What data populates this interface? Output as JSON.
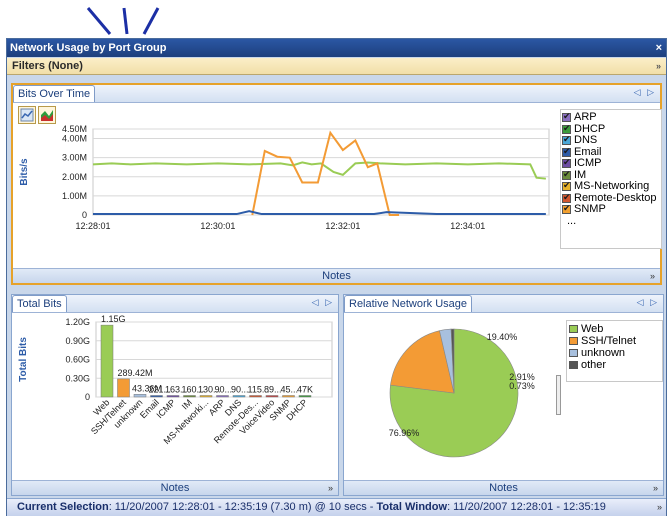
{
  "window": {
    "title": "Network Usage by Port Group",
    "close_glyph": "×"
  },
  "filters": {
    "label": "Filters (None)",
    "chevron": "»"
  },
  "bits_panel": {
    "tab": "Bits Over Time",
    "arrows": "◁ ▷",
    "notes": "Notes",
    "notes_chevron": "»",
    "legend": [
      {
        "label": "ARP",
        "color": "#8a6fc0"
      },
      {
        "label": "DHCP",
        "color": "#3c9c3c"
      },
      {
        "label": "DNS",
        "color": "#4aa7d8"
      },
      {
        "label": "Email",
        "color": "#2d5ca8"
      },
      {
        "label": "ICMP",
        "color": "#6e4da3"
      },
      {
        "label": "IM",
        "color": "#6a8b3a"
      },
      {
        "label": "MS-Networking",
        "color": "#e6b22a"
      },
      {
        "label": "Remote-Desktop",
        "color": "#d2562e"
      },
      {
        "label": "SNMP",
        "color": "#f2a030"
      }
    ],
    "legend_more": "..."
  },
  "total_panel": {
    "tab": "Total Bits",
    "arrows": "◁ ▷",
    "notes": "Notes",
    "notes_chevron": "»"
  },
  "relative_panel": {
    "tab": "Relative Network Usage",
    "arrows": "◁ ▷",
    "notes": "Notes",
    "notes_chevron": "»",
    "legend": [
      {
        "label": "Web",
        "color": "#9acc55"
      },
      {
        "label": "SSH/Telnet",
        "color": "#f39b35"
      },
      {
        "label": "unknown",
        "color": "#a8c0de"
      },
      {
        "label": "other",
        "color": "#555555"
      }
    ]
  },
  "status": {
    "current_label": "Current Selection",
    "current_value": ": 11/20/2007 12:28:01 - 12:35:19 (7.30 m) @ 10 secs  - ",
    "total_label": "Total Window",
    "total_value": ": 11/20/2007 12:28:01 - 12:35:19",
    "chevron": "»"
  },
  "chart_data": [
    {
      "type": "line",
      "ylabel": "Bits/s",
      "ytick_labels": [
        "0",
        "1.00M",
        "2.00M",
        "3.00M",
        "4.00M",
        "4.50M"
      ],
      "ytick_values": [
        0,
        1000000,
        2000000,
        3000000,
        4000000,
        4500000
      ],
      "ylim": [
        0,
        4500000
      ],
      "xtick_labels": [
        "12:28:01",
        "12:30:01",
        "12:32:01",
        "12:34:01"
      ],
      "xtick_minutes": [
        0,
        2,
        4,
        6
      ],
      "xlim_minutes": [
        0,
        7.3
      ],
      "grid": true,
      "series": [
        {
          "name": "Web",
          "color": "#9acc55",
          "x": [
            0,
            0.3,
            0.6,
            1,
            1.5,
            2,
            2.5,
            3,
            3.2,
            3.35,
            3.5,
            3.65,
            3.85,
            4,
            4.2,
            4.4,
            4.6,
            5,
            5.5,
            6,
            6.5,
            7.0,
            7.1,
            7.25
          ],
          "y": [
            2650000,
            2700000,
            2650000,
            2700000,
            2650000,
            2700000,
            2650000,
            2700000,
            2600000,
            2750000,
            2650000,
            2700000,
            2250000,
            2100000,
            2700000,
            2750000,
            2700000,
            2650000,
            2700000,
            2650000,
            2700000,
            2650000,
            1950000,
            1900000
          ]
        },
        {
          "name": "SSH/Telnet",
          "color": "#f39b35",
          "x": [
            2.55,
            2.75,
            2.95,
            3.15,
            3.35,
            3.6,
            3.8,
            4.0,
            4.2,
            4.4,
            4.55,
            4.75,
            4.9
          ],
          "y": [
            0,
            3350000,
            3050000,
            3000000,
            1700000,
            1700000,
            4300000,
            3400000,
            3900000,
            2500000,
            2700000,
            0,
            0
          ]
        },
        {
          "name": "other",
          "color": "#2d5ca8",
          "x": [
            0,
            1,
            2.3,
            2.5,
            2.7,
            3.5,
            4.5,
            4.7,
            5.5,
            7.25
          ],
          "y": [
            50000,
            50000,
            50000,
            200000,
            50000,
            50000,
            50000,
            150000,
            50000,
            50000
          ]
        }
      ]
    },
    {
      "type": "bar",
      "ylabel": "Total Bits",
      "ytick_labels": [
        "0",
        "0.30G",
        "0.60G",
        "0.90G",
        "1.20G"
      ],
      "ylim": [
        0,
        1.2
      ],
      "grid": true,
      "categories": [
        "Web",
        "SSH/Telnet",
        "unknown",
        "Email",
        "ICMP",
        "IM",
        "MS-Networki...",
        "ARP",
        "DNS",
        "Remote-Des...",
        "VoiceVideo",
        "SNMP",
        "DHCP"
      ],
      "values": [
        1150000000,
        289420000,
        43360000,
        22000000,
        16000000,
        16000000,
        13000000,
        9000000,
        9000000,
        11000000,
        8000000,
        5000000,
        4000000
      ],
      "data_labels": [
        "1.15G",
        "289.42M",
        "43.36M",
        "221...",
        "163...",
        "160...",
        "130...",
        "90...",
        "90...",
        "115...",
        "89...",
        "45...",
        "47K"
      ],
      "colors": [
        "#9acc55",
        "#f39b35",
        "#a8c0de",
        "#2d5ca8",
        "#6e4da3",
        "#6a8b3a",
        "#e6b22a",
        "#8a6fc0",
        "#4aa7d8",
        "#d2562e",
        "#c04040",
        "#f2a030",
        "#3c9c3c"
      ]
    },
    {
      "type": "pie",
      "labels": [
        "Web",
        "SSH/Telnet",
        "unknown",
        "other"
      ],
      "values": [
        76.96,
        19.4,
        2.91,
        0.73
      ],
      "data_labels": [
        "76.96%",
        "19.40%",
        "2.91%",
        "0.73%"
      ],
      "colors": [
        "#9acc55",
        "#f39b35",
        "#a8c0de",
        "#555555"
      ]
    }
  ]
}
